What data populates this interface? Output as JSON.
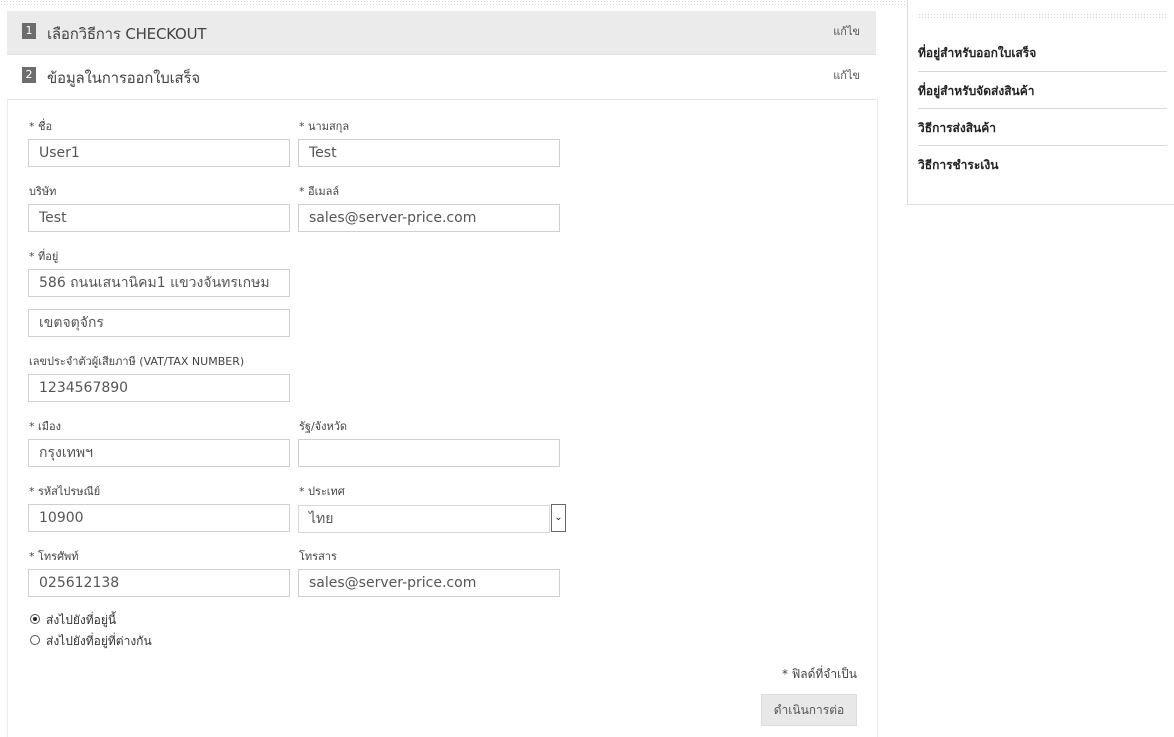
{
  "steps": [
    {
      "number": "1",
      "title": "เลือกวิธีการ CHECKOUT",
      "edit_label": "แก้ไข"
    },
    {
      "number": "2",
      "title": "ข้อมูลในการออกใบเสร็จ",
      "edit_label": "แก้ไข"
    }
  ],
  "form": {
    "first_name": {
      "label": "* ชื่อ",
      "value": "User1"
    },
    "last_name": {
      "label": "* นามสกุล",
      "value": "Test"
    },
    "company": {
      "label": "บริษัท",
      "value": "Test"
    },
    "email": {
      "label": "* อีเมลล์",
      "value": "sales@server-price.com"
    },
    "address": {
      "label": "* ที่อยู่",
      "line1": "586 ถนนเสนานิคม1 แขวงจันทรเกษม",
      "line2": "เขตจตุจักร"
    },
    "tax_number": {
      "label": "เลขประจำตัวผู้เสียภาษี (VAT/TAX NUMBER)",
      "value": "1234567890"
    },
    "city": {
      "label": "* เมือง",
      "value": "กรุงเทพฯ"
    },
    "state": {
      "label": "รัฐ/จังหวัด",
      "value": ""
    },
    "postcode": {
      "label": "* รหัสไปรษณีย์",
      "value": "10900"
    },
    "country": {
      "label": "* ประเทศ",
      "value": "ไทย"
    },
    "phone": {
      "label": "* โทรศัพท์",
      "value": "025612138"
    },
    "fax": {
      "label": "โทรสาร",
      "value": "sales@server-price.com"
    }
  },
  "shipping_options": [
    {
      "label": "ส่งไปยังที่อยู่นี้",
      "selected": true
    },
    {
      "label": "ส่งไปยังที่อยู่ที่ต่างกัน",
      "selected": false
    }
  ],
  "required_note": "* ฟิลด์ที่จำเป็น",
  "continue_label": "ดำเนินการต่อ",
  "sidebar": {
    "items": [
      "ที่อยู่สำหรับออกใบเสร็จ",
      "ที่อยู่สำหรับจัดส่งสินค้า",
      "วิธีการส่งสินค้า",
      "วิธีการชำระเงิน"
    ]
  }
}
